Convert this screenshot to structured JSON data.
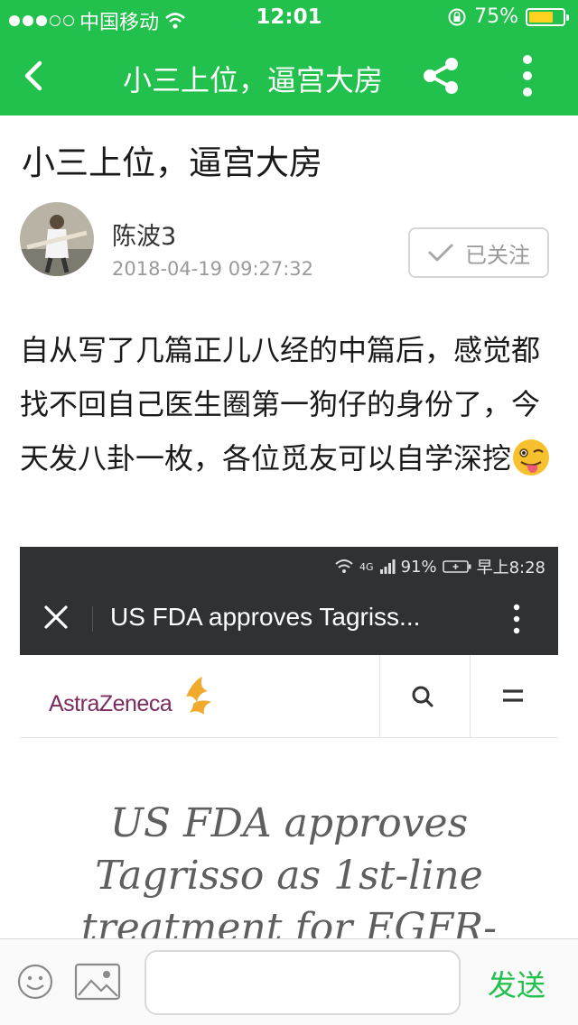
{
  "status_bar": {
    "carrier": "中国移动",
    "time": "12:01",
    "battery_percent": "75%",
    "battery_level": 0.75
  },
  "nav": {
    "title": "小三上位，逼宫大房",
    "accent_color": "#22c04c"
  },
  "article": {
    "title": "小三上位，逼宫大房",
    "author": "陈波3",
    "date": "2018-04-19 09:27:32",
    "follow_label": "已关注",
    "body": "自从写了几篇正儿八经的中篇后，感觉都找不回自己医生圈第一狗仔的身份了，今天发八卦一枚，各位觅友可以自学深挖"
  },
  "embedded_screenshot": {
    "status": {
      "network": "4G",
      "battery": "91%",
      "time": "早上8:28"
    },
    "tab_title": "US FDA approves Tagriss...",
    "logo_text": "AstraZeneca",
    "headline_lines": [
      "US FDA approves",
      "Tagrisso as 1st-line",
      "treatment for EGFR-"
    ]
  },
  "bottom_bar": {
    "input_value": "",
    "send_label": "发送"
  }
}
